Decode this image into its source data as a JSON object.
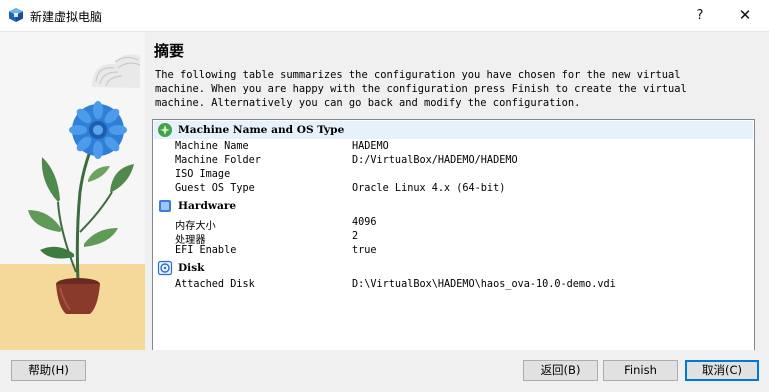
{
  "window": {
    "title": "新建虚拟电脑",
    "help_glyph": "?",
    "close_glyph": "✕",
    "app_icon": "virtualbox-cube-icon"
  },
  "main": {
    "heading": "摘要",
    "description_lines": [
      "The following table summarizes the configuration you have chosen for the new virtual",
      "machine. When you are happy with the configuration press Finish to create the virtual",
      "machine. Alternatively you can go back and modify the configuration."
    ]
  },
  "summary": {
    "sections": [
      {
        "title": "Machine Name and OS Type",
        "icon": "os-type-icon",
        "rows": [
          {
            "key": "Machine Name",
            "value": "HADEMO"
          },
          {
            "key": "Machine Folder",
            "value": "D:/VirtualBox/HADEMO/HADEMO"
          },
          {
            "key": "ISO Image",
            "value": ""
          },
          {
            "key": "Guest OS Type",
            "value": "Oracle Linux 4.x (64-bit)"
          }
        ]
      },
      {
        "title": "Hardware",
        "icon": "chip-icon",
        "rows": [
          {
            "key": "内存大小",
            "value": "4096"
          },
          {
            "key": "处理器",
            "value": "2"
          },
          {
            "key": "EFI Enable",
            "value": "true"
          }
        ]
      },
      {
        "title": "Disk",
        "icon": "hard-disk-icon",
        "rows": [
          {
            "key": "Attached Disk",
            "value": "D:\\VirtualBox\\HADEMO\\haos_ova-10.0-demo.vdi"
          }
        ]
      }
    ]
  },
  "buttons": {
    "help": "帮助(H)",
    "back": "返回(B)",
    "finish": "Finish",
    "cancel": "取消(C)"
  },
  "colors": {
    "accent": "#0078d7",
    "selection": "#e5f1fb",
    "flower": "#2f7fd6",
    "pot": "#8a3a2a",
    "floor": "#f4d99a"
  }
}
